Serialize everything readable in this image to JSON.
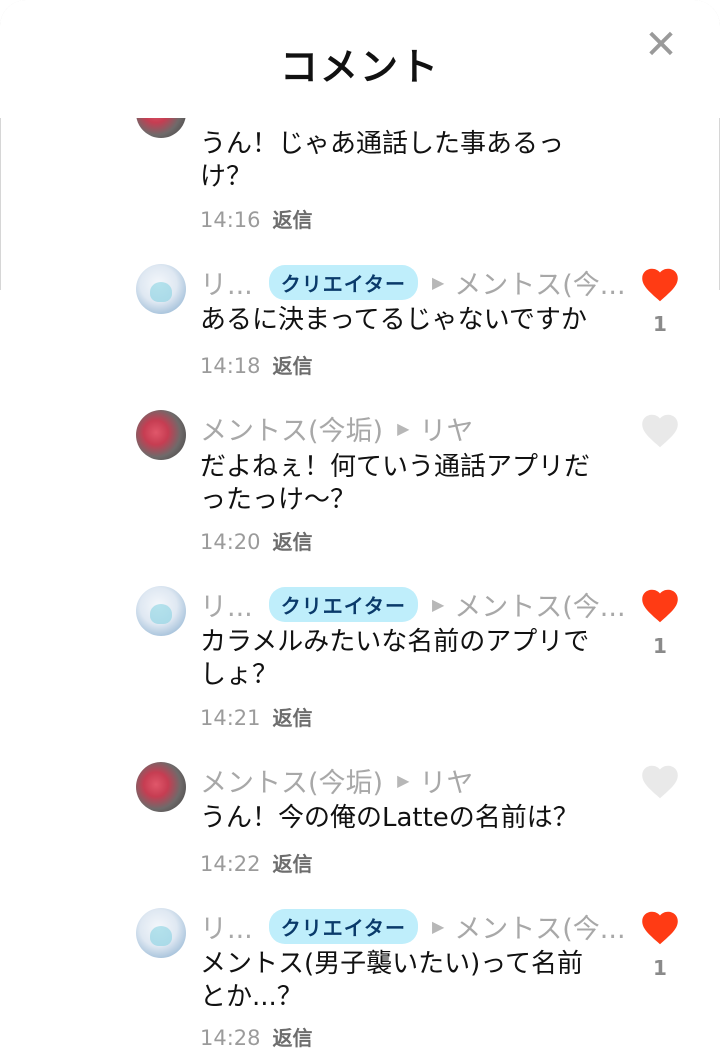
{
  "header": {
    "title": "コメント",
    "close_icon": "close-icon"
  },
  "colors": {
    "heart_liked": "#ff3b14",
    "heart_empty": "#e9e9e9",
    "badge_bg": "#bfeefb"
  },
  "comments": [
    {
      "author": "",
      "target": "",
      "text": "うん！じゃあ通話した事あるっ\nけ？",
      "time": "14:16",
      "reply_label": "返信",
      "liked": null,
      "likes": ""
    },
    {
      "author": "リ...",
      "badge": "クリエイター",
      "target": "メントス(今...",
      "text": "あるに決まってるじゃないですか",
      "time": "14:18",
      "reply_label": "返信",
      "liked": true,
      "likes": "1"
    },
    {
      "author": "メントス(今垢)",
      "badge": "",
      "target": "リヤ",
      "text": "だよねぇ！何ていう通話アプリだ\nったっけ〜？",
      "time": "14:20",
      "reply_label": "返信",
      "liked": false,
      "likes": ""
    },
    {
      "author": "リ...",
      "badge": "クリエイター",
      "target": "メントス(今...",
      "text": "カラメルみたいな名前のアプリで\nしょ？",
      "time": "14:21",
      "reply_label": "返信",
      "liked": true,
      "likes": "1"
    },
    {
      "author": "メントス(今垢)",
      "badge": "",
      "target": "リヤ",
      "text": "うん！今の俺のLatteの名前は？",
      "time": "14:22",
      "reply_label": "返信",
      "liked": false,
      "likes": ""
    },
    {
      "author": "リ...",
      "badge": "クリエイター",
      "target": "メントス(今...",
      "text": "メントス(男子襲いたい)って名前\nとか...？",
      "time": "14:28",
      "reply_label": "返信",
      "liked": true,
      "likes": "1"
    }
  ]
}
